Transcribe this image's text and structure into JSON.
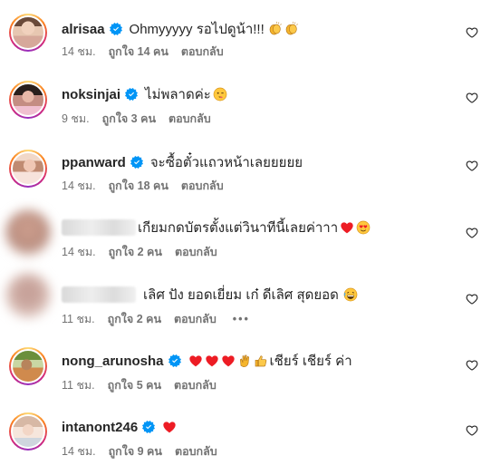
{
  "comments": [
    {
      "username": "alrisaa",
      "text": "Ohmyyyyy รอไปดูน้า!!!",
      "time": "14 ชม.",
      "likes": "ถูกใจ 14 คน",
      "reply": "ตอบกลับ"
    },
    {
      "username": "noksinjai",
      "text": "ไม่พลาดค่ะ",
      "time": "9 ชม.",
      "likes": "ถูกใจ 3 คน",
      "reply": "ตอบกลับ"
    },
    {
      "username": "ppanward",
      "text": "จะซื้อตั๋วแถวหน้าเลยยยยย",
      "time": "14 ชม.",
      "likes": "ถูกใจ 18 คน",
      "reply": "ตอบกลับ"
    },
    {
      "username": "",
      "text": "เกียมกดบัตรตั้งแต่วินาทีนี้เลยค่าาา",
      "time": "14 ชม.",
      "likes": "ถูกใจ 2 คน",
      "reply": "ตอบกลับ"
    },
    {
      "username": "",
      "text": "เลิศ ปัง ยอดเยี่ยม เก๋ ดีเลิศ สุดยอด",
      "time": "11 ชม.",
      "likes": "ถูกใจ 2 คน",
      "reply": "ตอบกลับ",
      "more": "•••"
    },
    {
      "username": "nong_arunosha",
      "text": "เชียร์ เชียร์ ค่า",
      "time": "11 ชม.",
      "likes": "ถูกใจ 5 คน",
      "reply": "ตอบกลับ"
    },
    {
      "username": "intanont246",
      "text": "",
      "time": "14 ชม.",
      "likes": "ถูกใจ 9 คน",
      "reply": "ตอบกลับ"
    }
  ],
  "colors": {
    "verified": "#0095f6",
    "heart": "#ed1c24",
    "meta": "#737373"
  },
  "icons": [
    "verified-badge-icon",
    "heart-outline-icon",
    "clap-emoji-icon",
    "wink-emoji-icon",
    "heart-emoji-icon",
    "heart-eyes-emoji-icon",
    "grin-emoji-icon",
    "hand-emoji-icon",
    "thumbs-up-emoji-icon"
  ]
}
